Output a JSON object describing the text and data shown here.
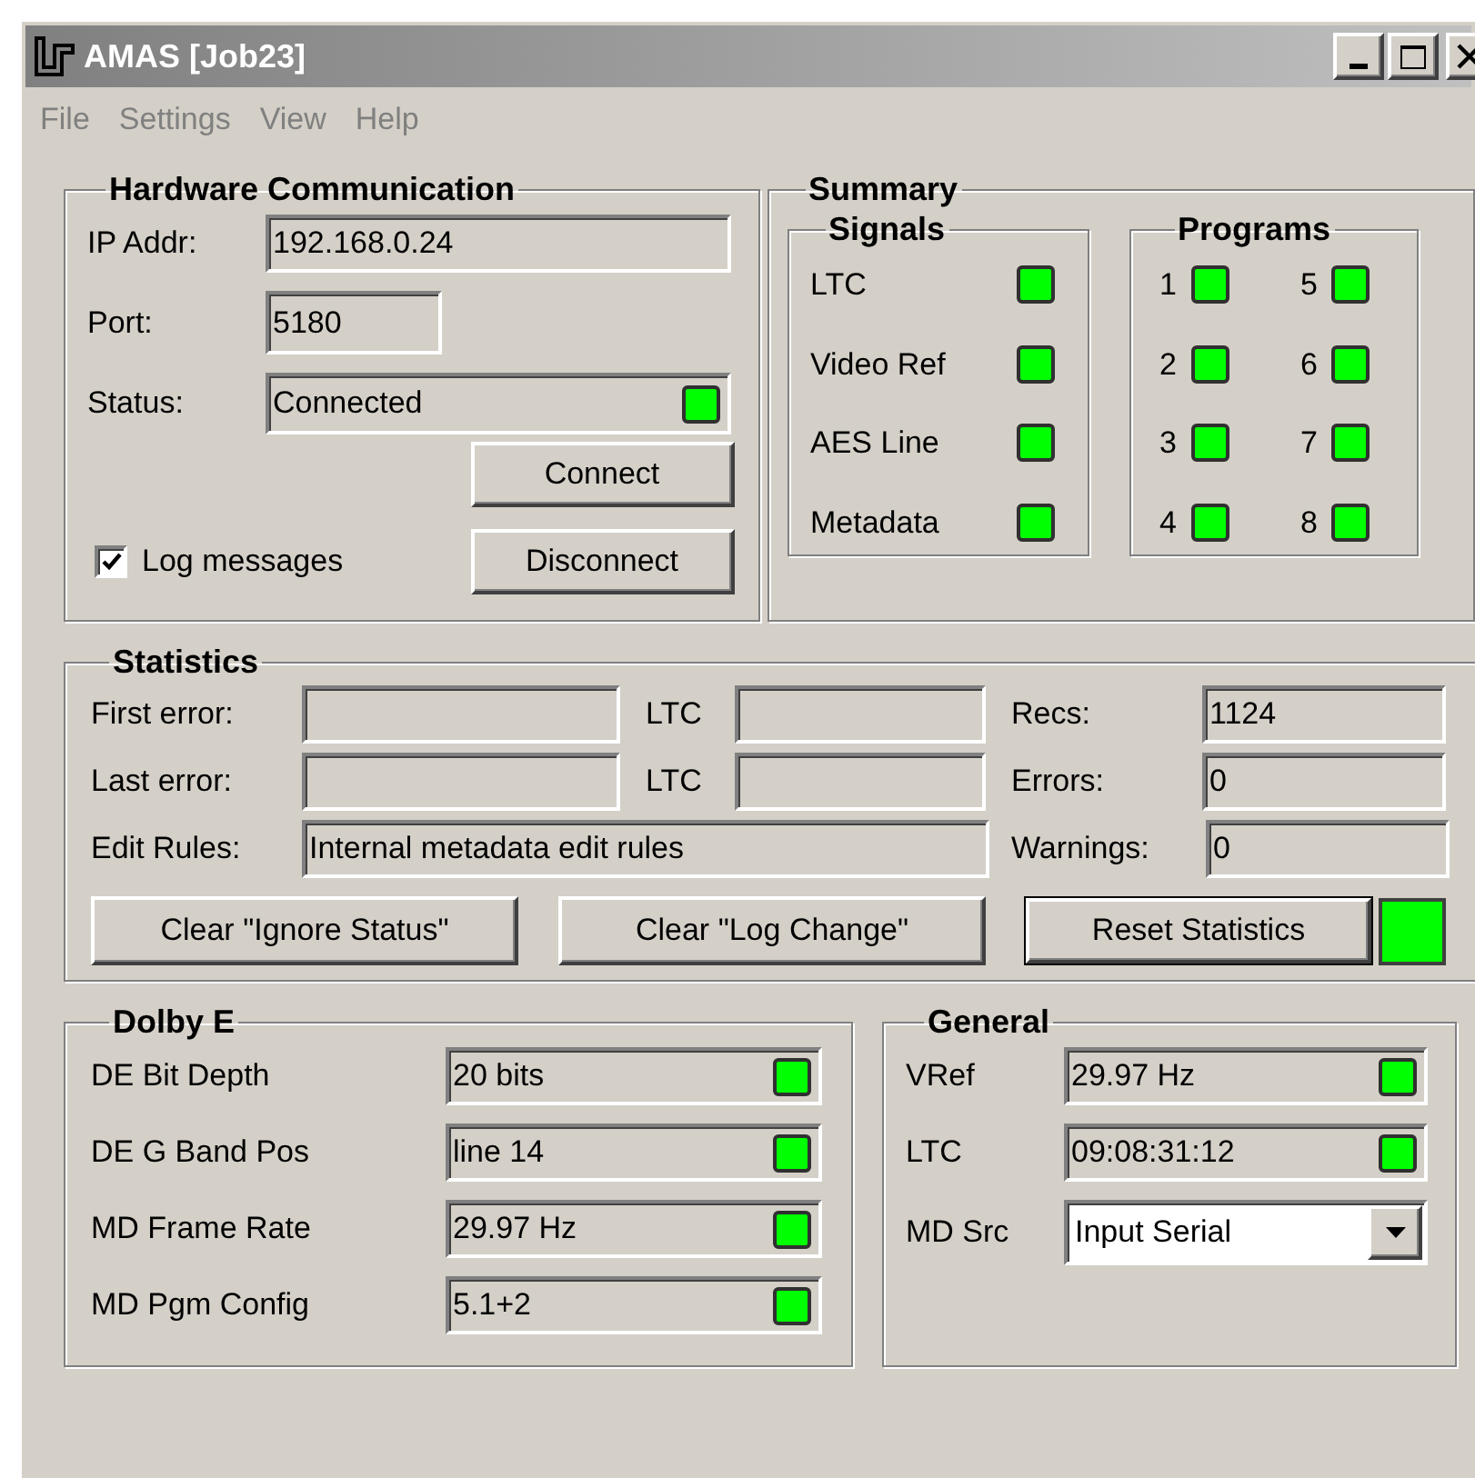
{
  "window": {
    "title": "AMAS [Job23]"
  },
  "menu": [
    "File",
    "Settings",
    "View",
    "Help"
  ],
  "hardware": {
    "title": "Hardware Communication",
    "ip": {
      "label": "IP Addr:",
      "value": "192.168.0.24"
    },
    "port": {
      "label": "Port:",
      "value": "5180"
    },
    "status": {
      "label": "Status:",
      "value": "Connected",
      "lit": true
    },
    "buttons": [
      "Connect",
      "Disconnect"
    ],
    "log": {
      "label": "Log messages",
      "checked": true
    }
  },
  "summary": {
    "title": "Summary",
    "signals": {
      "title": "Signals",
      "items": [
        {
          "label": "LTC",
          "lit": true
        },
        {
          "label": "Video Ref",
          "lit": true
        },
        {
          "label": "AES Line",
          "lit": true
        },
        {
          "label": "Metadata",
          "lit": true
        }
      ]
    },
    "programs": {
      "title": "Programs",
      "items": [
        {
          "label": "1",
          "lit": true
        },
        {
          "label": "2",
          "lit": true
        },
        {
          "label": "3",
          "lit": true
        },
        {
          "label": "4",
          "lit": true
        },
        {
          "label": "5",
          "lit": true
        },
        {
          "label": "6",
          "lit": true
        },
        {
          "label": "7",
          "lit": true
        },
        {
          "label": "8",
          "lit": true
        }
      ]
    }
  },
  "statistics": {
    "title": "Statistics",
    "rows": [
      {
        "label": "First error:",
        "ltc_label": "LTC",
        "count_label": "Recs:",
        "count": "1124"
      },
      {
        "label": "Last error:",
        "ltc_label": "LTC",
        "count_label": "Errors:",
        "count": "0"
      }
    ],
    "edit_rules": {
      "label": "Edit Rules:",
      "value": "Internal metadata edit rules",
      "count_label": "Warnings:",
      "count": "0"
    },
    "buttons": [
      {
        "label": "Clear \"Ignore Status\"",
        "default": false
      },
      {
        "label": "Clear \"Log Change\"",
        "default": false
      },
      {
        "label": "Reset Statistics",
        "default": true
      }
    ],
    "lit": true
  },
  "dolby": {
    "title": "Dolby E",
    "rows": [
      {
        "label": "DE Bit Depth",
        "value": "20 bits",
        "lit": true
      },
      {
        "label": "DE G Band Pos",
        "value": "line 14",
        "lit": true
      },
      {
        "label": "MD Frame Rate",
        "value": "29.97 Hz",
        "lit": true
      },
      {
        "label": "MD Pgm Config",
        "value": "5.1+2",
        "lit": true
      }
    ]
  },
  "general": {
    "title": "General",
    "rows": [
      {
        "kind": "field",
        "label": "VRef",
        "value": "29.97 Hz",
        "lit": true
      },
      {
        "kind": "field",
        "label": "LTC",
        "value": "09:08:31:12",
        "lit": true
      },
      {
        "kind": "dropdown",
        "label": "MD Src",
        "value": "Input Serial"
      }
    ]
  }
}
